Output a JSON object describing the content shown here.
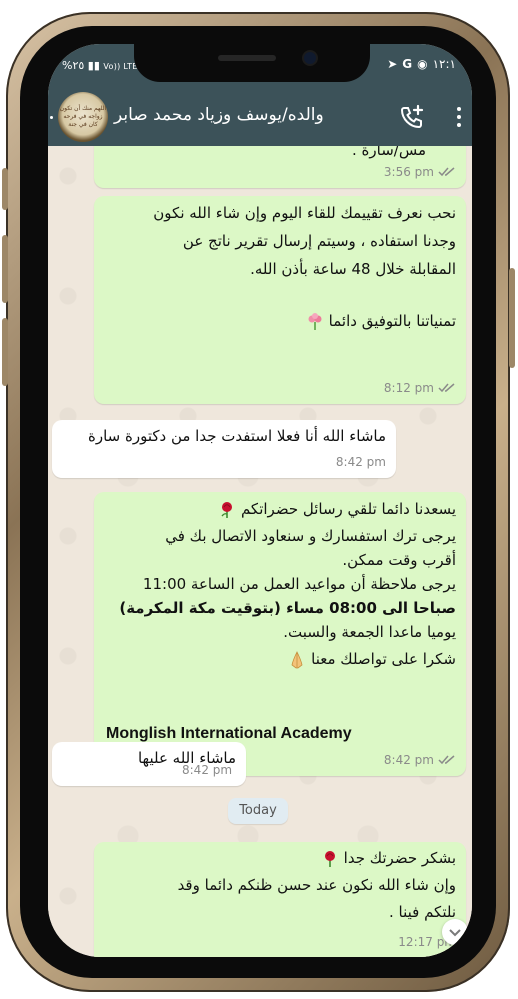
{
  "status_bar": {
    "battery": "%٢٥",
    "signal": "Vo)) LTE2",
    "time": "١٢:١",
    "carrier_g": "G"
  },
  "header": {
    "contact_name": "والده/يوسف وزياد محمد صابر",
    "avatar_text": "اللهم منك أن تكون زواجه في فرحه كان في جنة"
  },
  "messages": [
    {
      "id": "m1",
      "direction": "out",
      "lines": [
        "مس/سارة ."
      ],
      "time": "3:56 pm",
      "read": true
    },
    {
      "id": "m2",
      "direction": "out",
      "lines": [
        "نحب نعرف تقييمك للقاء اليوم وإن شاء الله نكون",
        "وجدنا استفاده ، وسيتم إرسال تقرير ناتج عن",
        "المقابلة خلال 48 ساعة بأذن الله.",
        "",
        "تمنياتنا بالتوفيق دائما"
      ],
      "time": "8:12 pm",
      "read": true
    },
    {
      "id": "m3",
      "direction": "in",
      "lines": [
        "ماشاء الله أنا فعلا استفدت جدا من دكتورة سارة"
      ],
      "time": "8:42 pm"
    },
    {
      "id": "m4",
      "direction": "out",
      "lines": [
        "يسعدنا دائما تلقي رسائل حضراتكم",
        "يرجى ترك استفسارك و سنعاود الاتصال بك في",
        "أقرب وقت ممكن.",
        "يرجى ملاحظة أن مواعيد العمل من الساعة 11:00",
        "صباحا الى 08:00 مساء (بتوقيت مكة المكرمة)",
        "يوميا ماعدا الجمعة والسبت.",
        "شكرا على تواصلك معنا",
        "",
        "Monglish International Academy"
      ],
      "time": "8:42 pm",
      "read": true
    },
    {
      "id": "m5",
      "direction": "in",
      "lines": [
        "ماشاء الله عليها"
      ],
      "time": "8:42 pm"
    },
    {
      "id": "m6",
      "direction": "out",
      "lines": [
        "بشكر حضرتك جدا",
        "وإن شاء الله نكون عند حسن ظنكم دائما وقد",
        "نلتكم فينا ."
      ],
      "time": "12:17 pm",
      "read": false
    }
  ],
  "day_separator": "Today",
  "colors": {
    "header": "#3c5259",
    "outgoing_bubble": "#dcf8c6",
    "incoming_bubble": "#ffffff",
    "chat_background": "#efe7dc",
    "read_ticks": "#8a8a8a"
  },
  "icons": [
    "add-call-icon",
    "menu-icon",
    "flower-bouquet-icon",
    "rose-icon",
    "praying-hands-icon",
    "double-check-icon",
    "chevron-down-icon"
  ]
}
